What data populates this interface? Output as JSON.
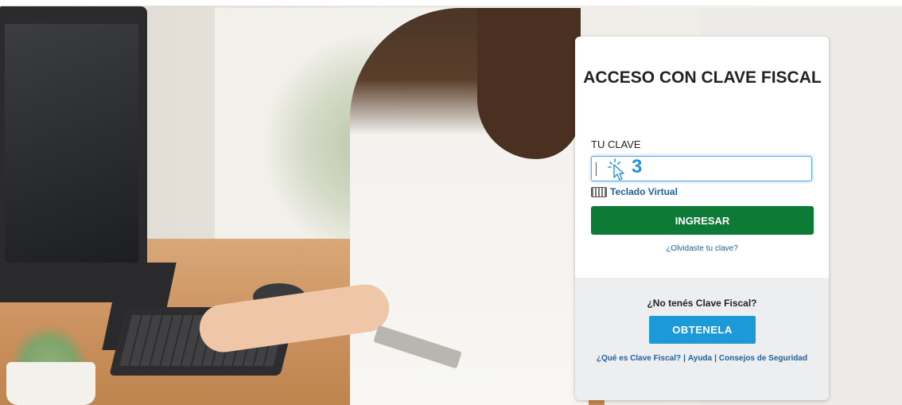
{
  "login": {
    "title": "ACCESO CON CLAVE FISCAL",
    "password_label": "TU CLAVE",
    "password_value": "",
    "step_number": "3",
    "virtual_keyboard_label": "Teclado Virtual",
    "submit_label": "INGRESAR",
    "forgot_link": "¿Olvidaste tu clave?"
  },
  "signup": {
    "prompt": "¿No tenés Clave Fiscal?",
    "button_label": "OBTENELA",
    "link_what_is": "¿Qué es Clave Fiscal?",
    "link_separator": "|",
    "link_help": "Ayuda",
    "link_security": "Consejos de Seguridad"
  },
  "colors": {
    "primary_green": "#0d7a35",
    "accent_blue": "#1c9ad8",
    "link_blue": "#1f5f9e"
  }
}
